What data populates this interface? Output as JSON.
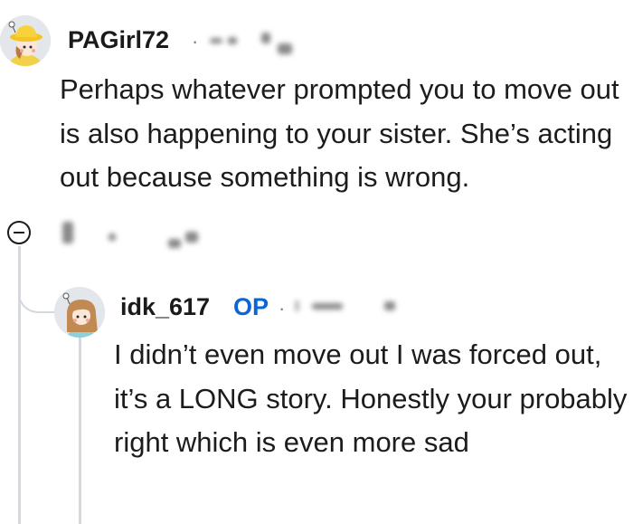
{
  "comments": [
    {
      "username": "PAGirl72",
      "separator": "·",
      "avatar": "bucket-hat-girl-avatar",
      "body": "Perhaps whatever prompted you to move out is also happening to your sister. She’s acting out because something is wrong."
    },
    {
      "username": "idk_617",
      "op_badge": "OP",
      "separator": "·",
      "avatar": "long-hair-girl-avatar",
      "body": "I didn’t even move out I was forced out, it’s a LONG story. Honestly your probably right which is even more sad"
    }
  ],
  "icons": {
    "collapse": "minus-circle-icon"
  },
  "colors": {
    "op_badge": "#0a66d6",
    "thread_line": "#d5d8dc",
    "text": "#1c1c1c"
  }
}
